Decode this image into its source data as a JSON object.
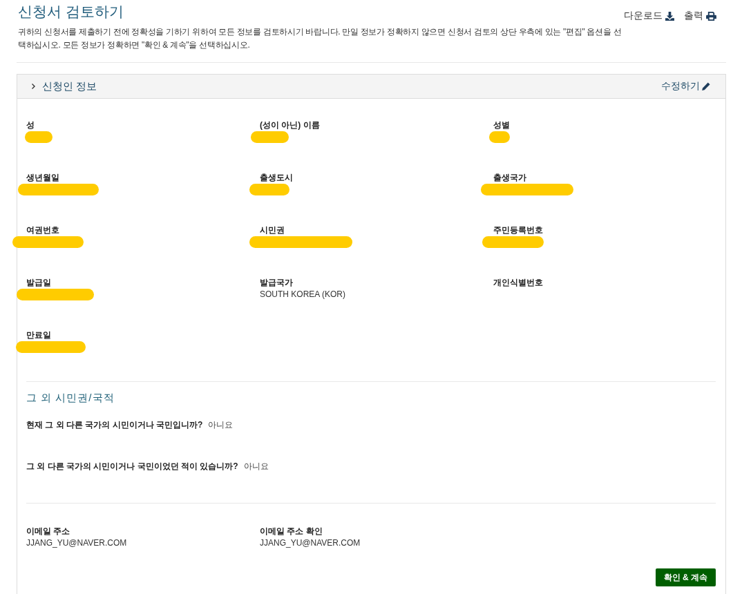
{
  "page": {
    "title": "신청서 검토하기",
    "description": "귀하의 신청서를 제출하기 전에 정확성을 기하기 위하여 모든 정보를 검토하시기 바랍니다. 만일 정보가 정확하지 않으면 신청서 검토의 상단 우측에 있는 \"편집\" 옵션을 선택하십시오. 모든 정보가 정확하면 \"확인 & 계속\"을 선택하십시오.",
    "actions": [
      {
        "kind": "download",
        "label": "다운로드"
      },
      {
        "kind": "print",
        "label": "출력"
      }
    ]
  },
  "applicant_info": {
    "title": "신청인 정보",
    "edit_label": "수정하기",
    "fields": [
      {
        "label": "성",
        "redacted": true
      },
      {
        "label": "(성이 아닌) 이름",
        "redacted": true
      },
      {
        "label": "성별",
        "redacted": true
      },
      {
        "label": "생년월일",
        "redacted": true
      },
      {
        "label": "출생도시",
        "redacted": true
      },
      {
        "label": "출생국가",
        "redacted": true
      },
      {
        "label": "여권번호",
        "redacted": true
      },
      {
        "label": "시민권",
        "redacted": true
      },
      {
        "label": "주민등록번호",
        "redacted": true
      },
      {
        "label": "발급일",
        "redacted": true
      },
      {
        "label": "발급국가",
        "value": "SOUTH KOREA (KOR)",
        "redacted": false
      },
      {
        "label": "개인식별번호",
        "redacted": false
      },
      {
        "label": "만료일",
        "redacted": true
      }
    ]
  },
  "other_citizenship": {
    "title": "그 외 시민권/국적",
    "questions": [
      {
        "question": "현재 그 외 다른 국가의 시민이거나 국민입니까?",
        "answer": "아니요"
      },
      {
        "question": "그 외 다른 국가의 시민이거나 국민이었던 적이 있습니까?",
        "answer": "아니요"
      }
    ]
  },
  "contact": {
    "fields": [
      {
        "label": "이메일 주소",
        "value": "JJANG_YU@NAVER.COM"
      },
      {
        "label": "이메일 주소 확인",
        "value": "JJANG_YU@NAVER.COM"
      }
    ]
  },
  "confirm_button": "확인 & 계속"
}
